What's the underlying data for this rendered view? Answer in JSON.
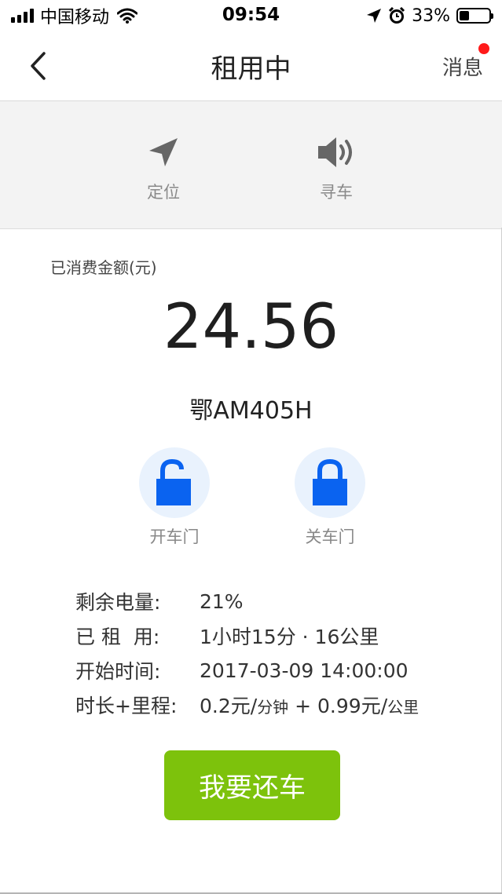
{
  "status_bar": {
    "carrier": "中国移动",
    "time": "09:54",
    "battery_percent": "33%",
    "battery_level": 0.33,
    "icons": [
      "signal-icon",
      "wifi-icon",
      "location-arrow-icon",
      "alarm-icon",
      "battery-icon"
    ]
  },
  "nav": {
    "title": "租用中",
    "message_label": "消息",
    "message_badge_color": "#ff1a1a",
    "back_icon": "chevron-left-icon"
  },
  "toolbar": {
    "locate_label": "定位",
    "locate_icon": "navigation-arrow-icon",
    "find_car_label": "寻车",
    "find_car_icon": "speaker-icon"
  },
  "fee": {
    "label": "已消费金额(元)",
    "amount": "24.56"
  },
  "vehicle": {
    "plate": "鄂AM405H"
  },
  "door_controls": {
    "open_label": "开车门",
    "open_icon": "unlock-icon",
    "close_label": "关车门",
    "close_icon": "lock-icon",
    "icon_color": "#0a63f0",
    "circle_color": "#e9f2fd"
  },
  "details": {
    "battery_key": "剩余电量:",
    "battery_value": "21%",
    "rented_key": "已 租  用:",
    "rented_value": "1小时15分 · 16公里",
    "start_key": "开始时间:",
    "start_value": "2017-03-09 14:00:00",
    "pricing_key": "时长+里程:",
    "pricing_time_price": "0.2元/",
    "pricing_time_unit": "分钟",
    "pricing_plus": " + ",
    "pricing_distance_price": "0.99元/",
    "pricing_distance_unit": "公里"
  },
  "action": {
    "return_label": "我要还车",
    "return_color": "#7dc20c"
  }
}
